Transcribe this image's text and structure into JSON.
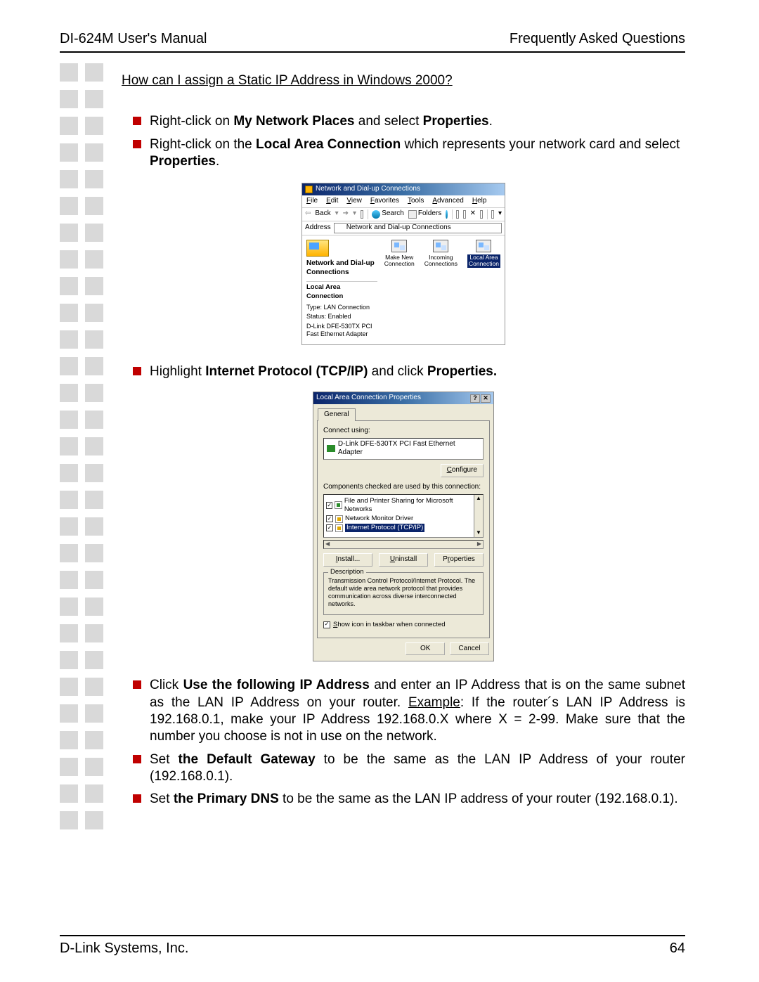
{
  "header": {
    "left": "DI-624M User's Manual",
    "right": "Frequently Asked Questions"
  },
  "question": "How can I assign a Static IP Address in Windows 2000?",
  "bullets_top": [
    {
      "pre": "Right-click on ",
      "b1": "My Network Places",
      "mid": " and select ",
      "b2": "Properties",
      "post": "."
    },
    {
      "pre": "Right-click on the ",
      "b1": "Local Area Connection",
      "mid": " which represents your network card and select ",
      "b2": "Properties",
      "post": "."
    }
  ],
  "bullet_mid": {
    "pre": "Highlight ",
    "b1": "Internet Protocol (TCP/IP)",
    "mid": " and click ",
    "b2": "Properties.",
    "post": ""
  },
  "bullets_bot": [
    {
      "pre": "Click ",
      "b1": "Use the following IP Address",
      "mid": " and enter an IP Address that is on the same subnet as the LAN IP Address on your router. ",
      "u": "Example",
      "rest": ": If the router´s LAN IP Address is 192.168.0.1, make your IP Address 192.168.0.X where X = 2-99. Make sure that the number you choose is not in use on the network."
    },
    {
      "pre": "Set ",
      "b1": "the Default Gateway",
      "mid": " to be the same as the LAN IP Address of your router (192.168.0.1).",
      "u": "",
      "rest": ""
    },
    {
      "pre": "Set ",
      "b1": "the Primary DNS",
      "mid": " to be the same as the LAN IP address of your router (192.168.0.1).",
      "u": "",
      "rest": ""
    }
  ],
  "fig1": {
    "title": "Network and Dial-up Connections",
    "menu": [
      "File",
      "Edit",
      "View",
      "Favorites",
      "Tools",
      "Advanced",
      "Help"
    ],
    "tb": {
      "back": "Back",
      "search": "Search",
      "folders": "Folders"
    },
    "addr_label": "Address",
    "addr_value": "Network and Dial-up Connections",
    "left_title": "Network and Dial-up Connections",
    "lac": "Local Area Connection",
    "type_label": "Type: LAN Connection",
    "status_label": "Status: Enabled",
    "adapter": "D-Link DFE-530TX PCI Fast Ethernet Adapter",
    "icons": [
      {
        "l1": "Make New",
        "l2": "Connection"
      },
      {
        "l1": "Incoming",
        "l2": "Connections"
      },
      {
        "l1": "Local Area",
        "l2": "Connection"
      }
    ]
  },
  "fig2": {
    "title": "Local Area Connection Properties",
    "tab": "General",
    "connect_using": "Connect using:",
    "adapter": "D-Link DFE-530TX PCI Fast Ethernet Adapter",
    "configure": "Configure",
    "components": "Components checked are used by this connection:",
    "items": [
      "File and Printer Sharing for Microsoft Networks",
      "Network Monitor Driver",
      "Internet Protocol (TCP/IP)"
    ],
    "install": "Install...",
    "uninstall": "Uninstall",
    "properties": "Properties",
    "desc_label": "Description",
    "desc_text": "Transmission Control Protocol/Internet Protocol. The default wide area network protocol that provides communication across diverse interconnected networks.",
    "show_icon": "Show icon in taskbar when connected",
    "ok": "OK",
    "cancel": "Cancel"
  },
  "footer": {
    "left": "D-Link Systems, Inc.",
    "right": "64"
  }
}
